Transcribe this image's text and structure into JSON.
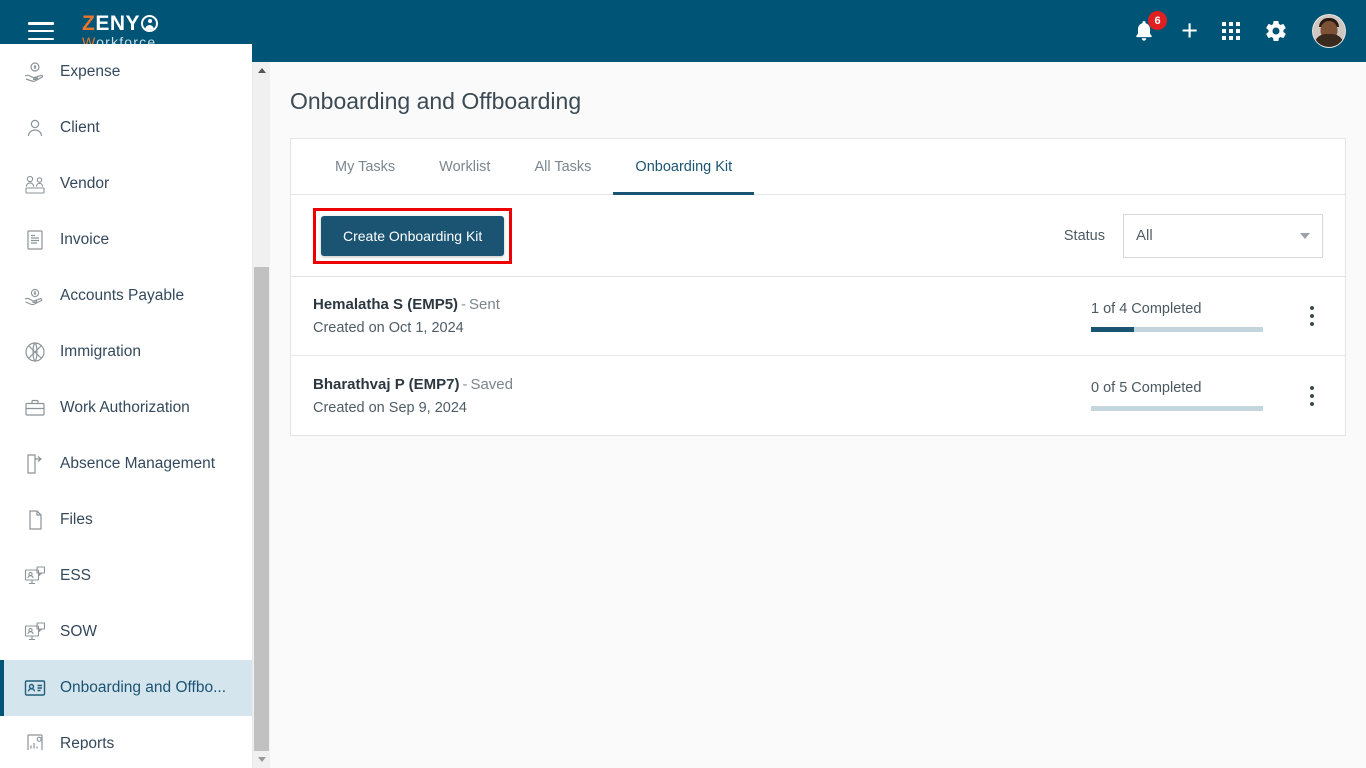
{
  "header": {
    "menu_icon": "hamburger-menu-icon",
    "logo": {
      "part1": "Z",
      "part2": "ENY",
      "part3": "W",
      "part4": "orkforce"
    },
    "notifications": {
      "icon": "bell-icon",
      "count": "6"
    },
    "add": {
      "icon": "plus-icon"
    },
    "apps": {
      "icon": "grid-apps-icon"
    },
    "settings": {
      "icon": "gear-icon"
    },
    "profile": {
      "icon": "avatar"
    },
    "bg_color": "#005476"
  },
  "sidebar": {
    "items": [
      {
        "label": "Expense",
        "icon": "expense-icon",
        "active": false
      },
      {
        "label": "Client",
        "icon": "person-icon",
        "active": false
      },
      {
        "label": "Vendor",
        "icon": "vendor-icon",
        "active": false
      },
      {
        "label": "Invoice",
        "icon": "invoice-icon",
        "active": false
      },
      {
        "label": "Accounts Payable",
        "icon": "accounts-payable-icon",
        "active": false
      },
      {
        "label": "Immigration",
        "icon": "immigration-icon",
        "active": false
      },
      {
        "label": "Work Authorization",
        "icon": "briefcase-icon",
        "active": false
      },
      {
        "label": "Absence Management",
        "icon": "absence-icon",
        "active": false
      },
      {
        "label": "Files",
        "icon": "files-icon",
        "active": false
      },
      {
        "label": "ESS",
        "icon": "ess-icon",
        "active": false
      },
      {
        "label": "SOW",
        "icon": "sow-icon",
        "active": false
      },
      {
        "label": "Onboarding and Offbo...",
        "icon": "id-card-icon",
        "active": true
      },
      {
        "label": "Reports",
        "icon": "reports-icon",
        "active": false
      }
    ],
    "active_bg": "#d4e5ed",
    "active_accent": "#005476"
  },
  "main": {
    "page_title": "Onboarding and Offboarding",
    "tabs": [
      {
        "label": "My Tasks",
        "active": false
      },
      {
        "label": "Worklist",
        "active": false
      },
      {
        "label": "All Tasks",
        "active": false
      },
      {
        "label": "Onboarding Kit",
        "active": true
      }
    ],
    "toolbar": {
      "create_label": "Create Onboarding Kit",
      "create_bg": "#1b5472",
      "highlight_color": "#ee0000",
      "status_label": "Status",
      "status_value": "All"
    },
    "rows": [
      {
        "name": "Hemalatha S (EMP5)",
        "separator": "-",
        "status": "Sent",
        "created": "Created on Oct 1, 2024",
        "progress_text": "1 of 4 Completed",
        "progress_percent": "25%",
        "menu_icon": "kebab-menu-icon"
      },
      {
        "name": "Bharathvaj P (EMP7)",
        "separator": "-",
        "status": "Saved",
        "created": "Created on Sep 9, 2024",
        "progress_text": "0 of 5 Completed",
        "progress_percent": "0%",
        "menu_icon": "kebab-menu-icon"
      }
    ]
  }
}
